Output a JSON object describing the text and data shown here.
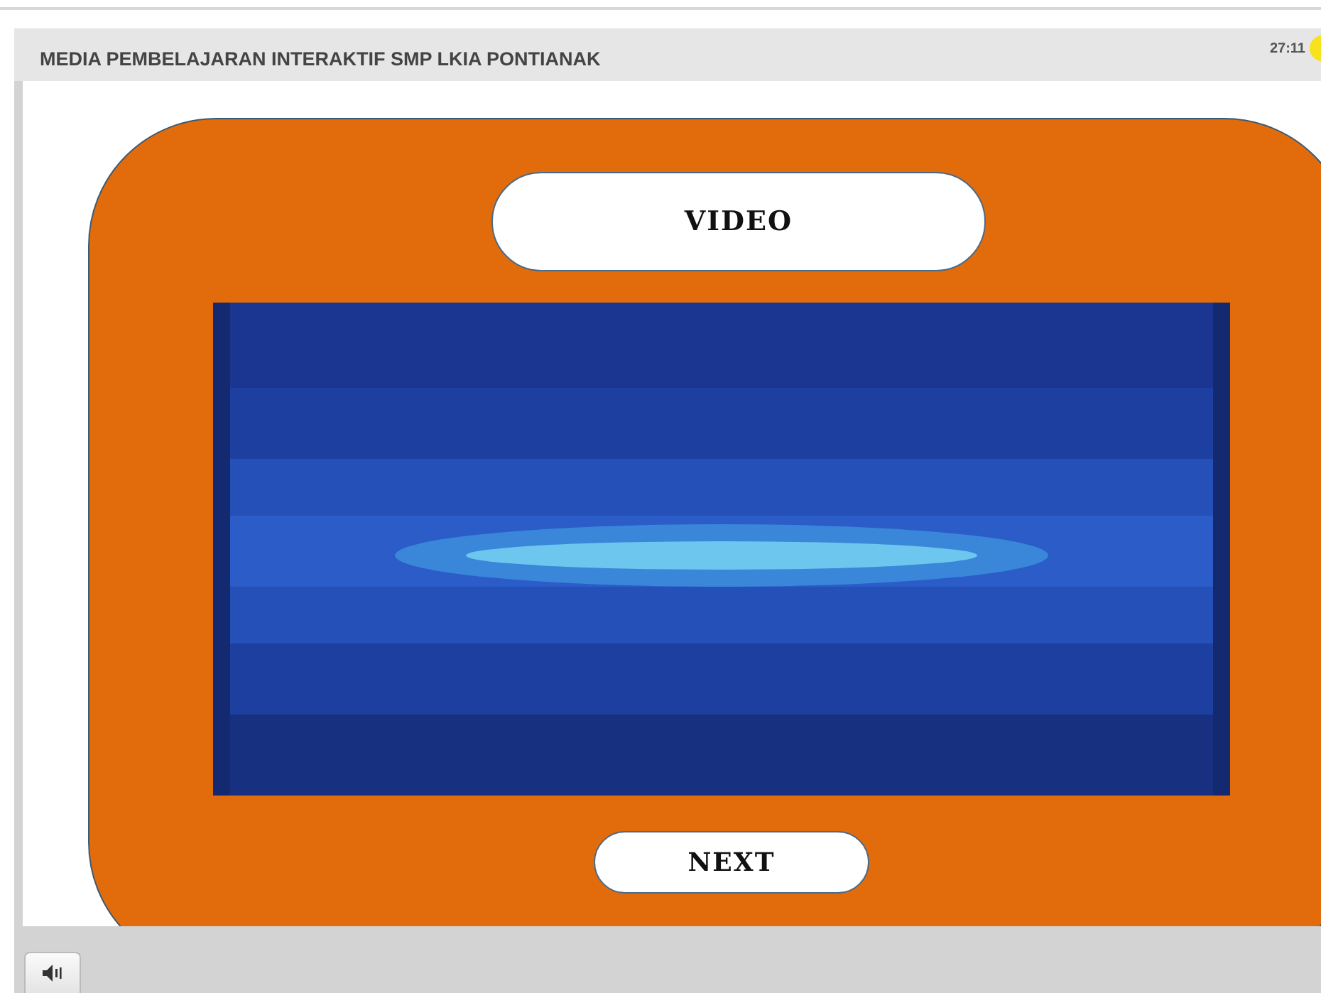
{
  "header": {
    "title": "MEDIA PEMBELAJARAN INTERAKTIF SMP LKIA PONTIANAK",
    "timer": "27:11"
  },
  "slide": {
    "heading": "VIDEO",
    "next_button": "NEXT"
  }
}
